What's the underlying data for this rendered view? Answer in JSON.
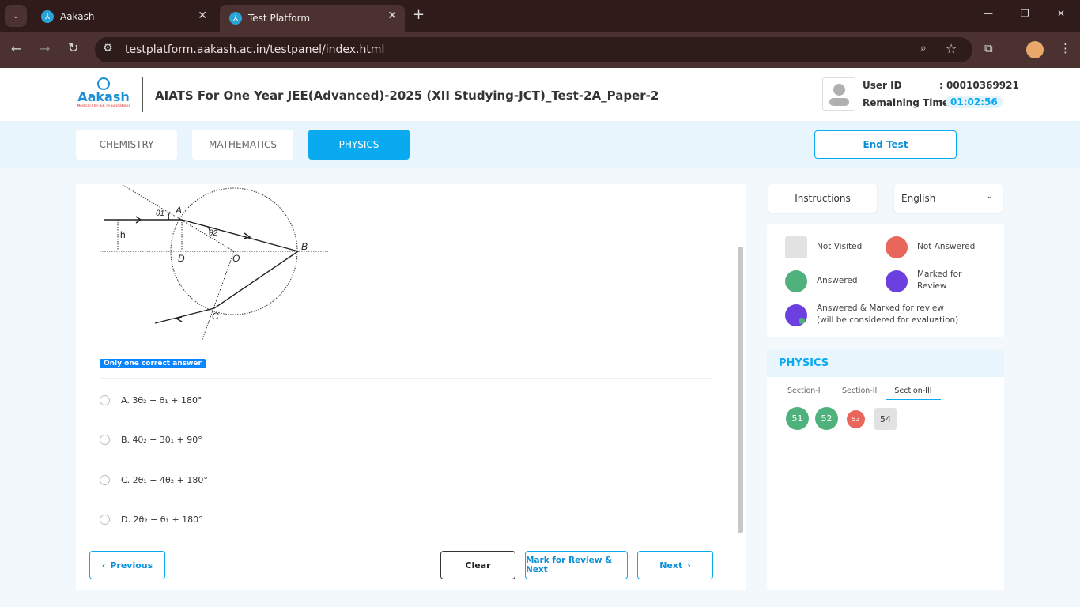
{
  "browser": {
    "tabs": [
      {
        "label": "Aakash"
      },
      {
        "label": "Test Platform",
        "active": true
      }
    ],
    "url": "testplatform.aakash.ac.in/testpanel/index.html"
  },
  "header": {
    "logo_text": "Aakash",
    "logo_sub": "Medical | IIT-JEE | Foundations",
    "title": "AIATS For One Year JEE(Advanced)-2025 (XII Studying-JCT)_Test-2A_Paper-2",
    "user_id_label": "User ID",
    "user_id": ": 00010369921",
    "time_label": "Remaining Time",
    "time_sep": ":",
    "time": "01:02:56"
  },
  "subjects": [
    {
      "label": "CHEMISTRY"
    },
    {
      "label": "MATHEMATICS"
    },
    {
      "label": "PHYSICS",
      "active": true
    }
  ],
  "end_test": "End Test",
  "question": {
    "diagram_labels": {
      "A": "A",
      "B": "B",
      "C": "C",
      "D": "D",
      "O": "O",
      "h": "h",
      "t1": "θ1",
      "t2": "θ2"
    },
    "type_badge": "Only one correct answer",
    "options": [
      {
        "label": "A. 3θ₂ − θ₁ + 180°"
      },
      {
        "label": "B. 4θ₂ − 3θ₁ + 90°"
      },
      {
        "label": "C. 2θ₁ − 4θ₂ + 180°"
      },
      {
        "label": "D. 2θ₂ − θ₁ + 180°"
      }
    ]
  },
  "nav": {
    "previous": "Previous",
    "clear": "Clear",
    "mark_review": "Mark for Review & Next",
    "next": "Next"
  },
  "side": {
    "instructions": "Instructions",
    "language": "English",
    "legend": [
      {
        "label": "Not Visited",
        "color": "#e2e2e2"
      },
      {
        "label": "Not Answered",
        "color": "#e8665a"
      },
      {
        "label": "Answered",
        "color": "#4fb27c"
      },
      {
        "label": "Marked for Review",
        "color": "#6c40e0"
      },
      {
        "label": "Answered & Marked for review",
        "sub": "(will be considered for evaluation)",
        "color": "#6c40e0"
      }
    ],
    "subject": "PHYSICS",
    "sections": [
      {
        "label": "Section-I"
      },
      {
        "label": "Section-II"
      },
      {
        "label": "Section-III",
        "active": true
      }
    ],
    "questions": [
      {
        "num": "51",
        "status": "answered"
      },
      {
        "num": "52",
        "status": "answered"
      },
      {
        "num": "53",
        "status": "not-answered"
      },
      {
        "num": "54",
        "status": "not-visited"
      }
    ]
  }
}
